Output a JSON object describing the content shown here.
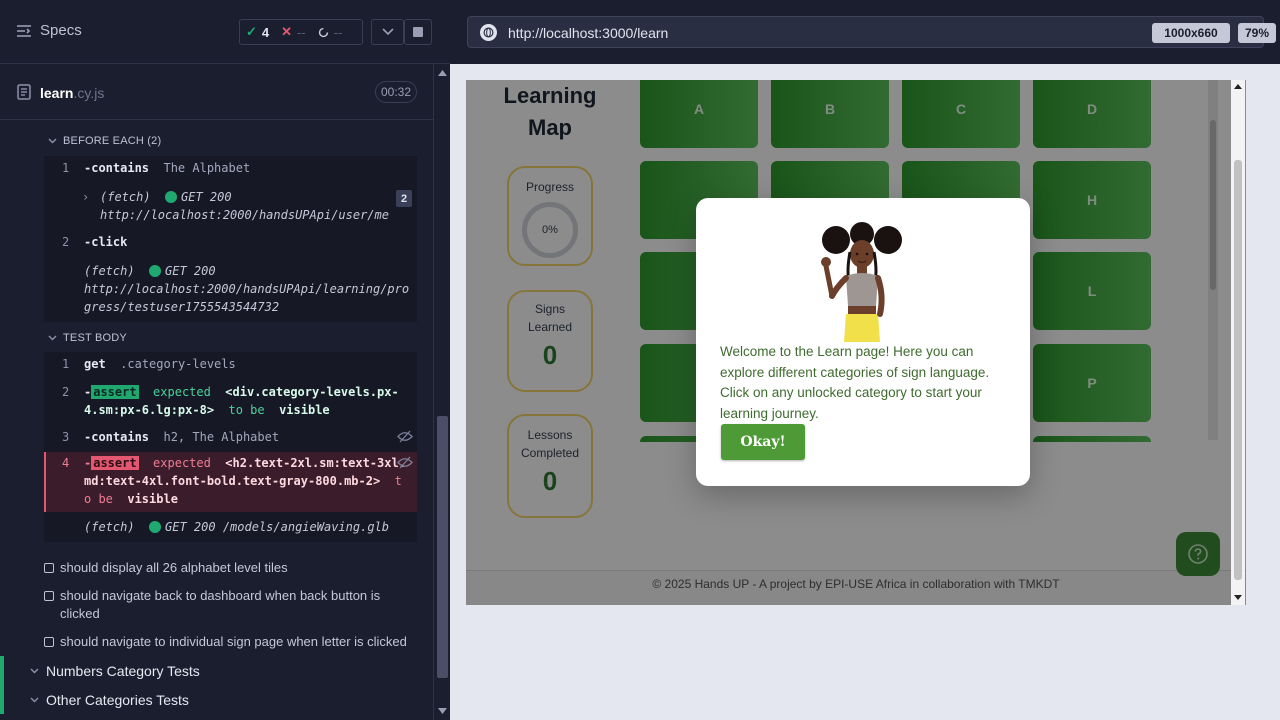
{
  "header": {
    "specs_label": "Specs",
    "passed_count": "4",
    "failed_count": "--",
    "pending_count": "--"
  },
  "file": {
    "name": "learn",
    "ext": ".cy.js",
    "duration": "00:32"
  },
  "before_each": {
    "title": "BEFORE EACH (2)",
    "cmd1_num": "1",
    "cmd1_name": "-contains",
    "cmd1_arg": "The Alphabet",
    "fetch1_label": "(fetch)",
    "fetch1_status": "GET 200",
    "fetch1_url": "http://localhost:2000/handsUPApi/user/me",
    "fetch1_badge": "2",
    "cmd2_num": "2",
    "cmd2_name": "-click",
    "fetch2_label": "(fetch)",
    "fetch2_status": "GET 200",
    "fetch2_url": "http://localhost:2000/handsUPApi/learning/progress/testuser1755543544732"
  },
  "test_body": {
    "title": "TEST BODY",
    "c1_num": "1",
    "c1_name": "get",
    "c1_arg": ".category-levels",
    "c2_num": "2",
    "c2_tag": "assert",
    "c2_expected": "expected",
    "c2_subject": "<div.category-levels.px-4.sm:px-6.lg:px-8>",
    "c2_tobe": "to be",
    "c2_value": "visible",
    "c3_num": "3",
    "c3_name": "-contains",
    "c3_arg": "h2, The Alphabet",
    "c4_num": "4",
    "c4_tag": "assert",
    "c4_expected": "expected",
    "c4_subject": "<h2.text-2xl.sm:text-3xl.md:text-4xl.font-bold.text-gray-800.mb-2>",
    "c4_tobe": "to be",
    "c4_value": "visible",
    "fetch3_label": "(fetch)",
    "fetch3_status": "GET 200 /models/angieWaving.glb"
  },
  "tests": [
    {
      "label": "should display all 26 alphabet level tiles"
    },
    {
      "label": "should navigate back to dashboard when back button is clicked"
    },
    {
      "label": "should navigate to individual sign page when letter is clicked"
    }
  ],
  "suites": [
    {
      "label": "Numbers Category Tests"
    },
    {
      "label": "Other Categories Tests"
    }
  ],
  "browser": {
    "url": "http://localhost:3000/learn",
    "viewport": "1000x660",
    "zoom": "79%"
  },
  "app": {
    "title_line1": "Learning",
    "title_line2": "Map",
    "progress_label": "Progress",
    "progress_value": "0%",
    "signs_label": "Signs Learned",
    "signs_value": "0",
    "lessons_label": "Lessons Completed",
    "lessons_value": "0",
    "tiles": [
      "A",
      "B",
      "C",
      "D",
      "H",
      "L",
      "P"
    ],
    "footer": "© 2025 Hands UP - A project by EPI-USE Africa in collaboration with TMKDT",
    "modal_text": "Welcome to the Learn page! Here you can explore different categories of sign language. Click on any unlocked category to start your learning journey.",
    "modal_button": "Okay!"
  },
  "colors": {
    "pass": "#1fa971",
    "fail": "#e45770",
    "tile_green": "#2f9a2f",
    "okay_button": "#4d9a37"
  }
}
